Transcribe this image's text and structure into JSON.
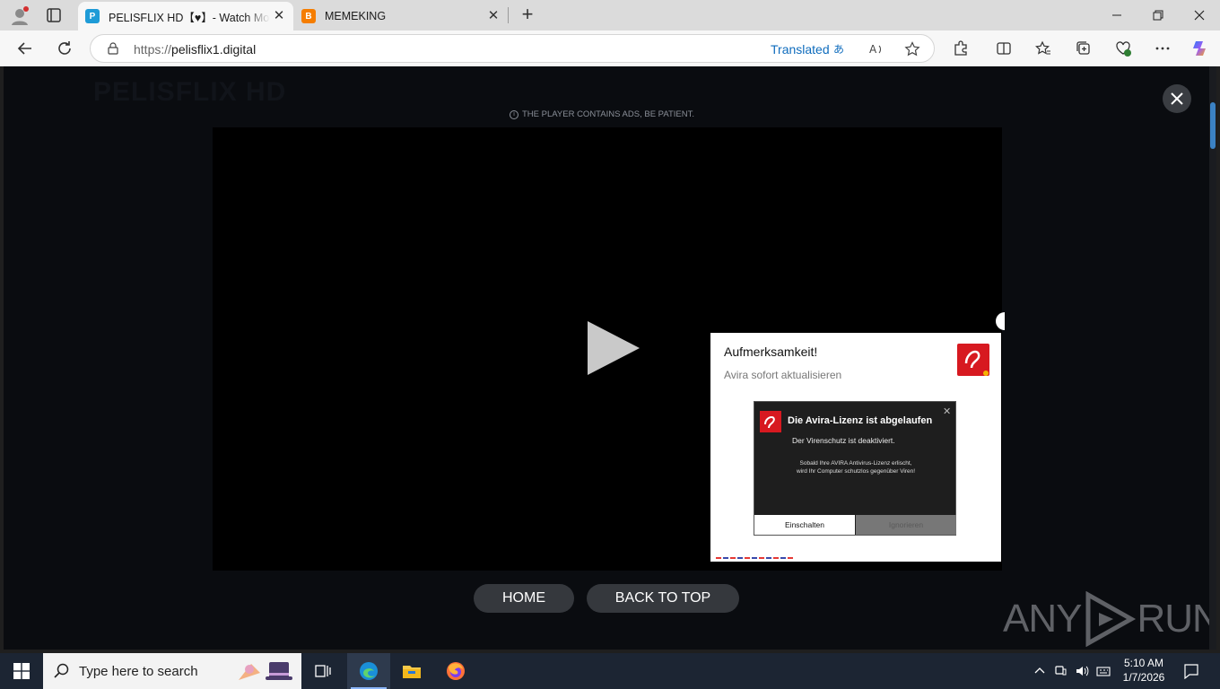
{
  "browser": {
    "tabs": [
      {
        "title": "PELISFLIX HD【♥】- Watch Movies",
        "favicon_letter": "P",
        "favicon_color": "#1e9bd7",
        "active": true
      },
      {
        "title": "MEMEKING",
        "favicon_letter": "B",
        "favicon_color": "#f57d00",
        "active": false
      }
    ],
    "address": {
      "scheme": "https://",
      "host": "pelisflix1.digital",
      "translated_label": "Translated"
    }
  },
  "page": {
    "logo_text": "PELISFLIX HD",
    "notice": "THE PLAYER CONTAINS ADS, BE PATIENT.",
    "buttons": {
      "home": "HOME",
      "back_to_top": "BACK TO TOP"
    }
  },
  "ad_popup": {
    "title": "Aufmerksamkeit!",
    "subtitle": "Avira sofort aktualisieren",
    "inner": {
      "title": "Die Avira-Lizenz ist abgelaufen",
      "line1": "Der Virenschutz ist deaktiviert.",
      "line2a": "Sobald Ihre AVIRA Antivirus-Lizenz erlischt,",
      "line2b": "wird Ihr Computer schutzlos gegenüber Viren!",
      "btn_enable": "Einschalten",
      "btn_ignore": "Ignorieren"
    },
    "brand_color": "#d71920"
  },
  "watermark": {
    "left": "ANY",
    "right": "RUN"
  },
  "taskbar": {
    "search_placeholder": "Type here to search",
    "time": "5:10 AM",
    "date": "1/7/2026"
  },
  "colors": {
    "accent": "#0f6cbd",
    "page_bg": "#0a0c10",
    "taskbar": "#1c2533"
  }
}
